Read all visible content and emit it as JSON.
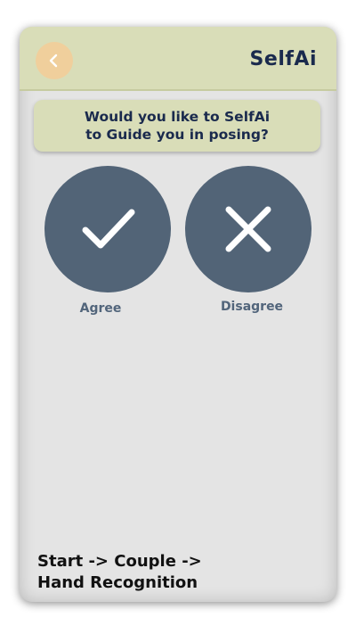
{
  "header": {
    "title": "SelfAi",
    "back_icon": "chevron-left-icon"
  },
  "banner": {
    "line1": "Would you like to SelfAi",
    "line2": "to Guide you in posing?"
  },
  "options": {
    "agree": {
      "label": "Agree",
      "icon": "check-icon"
    },
    "disagree": {
      "label": "Disagree",
      "icon": "close-icon"
    }
  },
  "footer": {
    "line1": "Start -> Couple ->",
    "line2": "Hand Recognition"
  },
  "colors": {
    "header_bg": "#d9ddb8",
    "back_button_bg": "#f0cf9c",
    "title_text": "#1a2a4d",
    "circle_bg": "#526477",
    "panel_bg": "#e4e4e4"
  }
}
